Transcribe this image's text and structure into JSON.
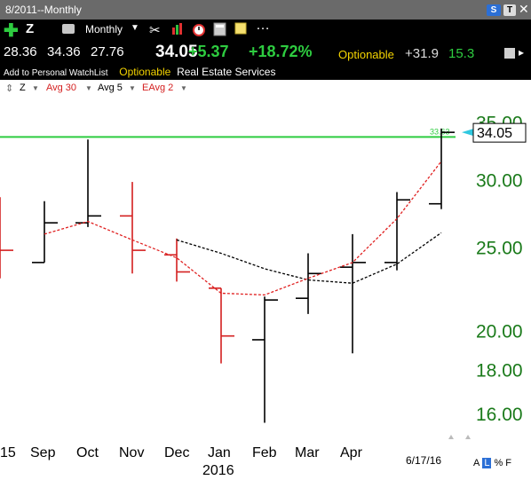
{
  "window": {
    "title": "8/2011--Monthly",
    "btn_s": "S",
    "btn_t": "T",
    "close": "✕"
  },
  "toolbar": {
    "symbol": "Z",
    "period": "Monthly",
    "add_label": "Add to Personal WatchList",
    "optionable": "Optionable",
    "industry": "Real Estate Services"
  },
  "quote": {
    "high": "28.36",
    "open": "34.36",
    "low": "27.76",
    "last": "34.05",
    "change": "+5.37",
    "change_pct": "+18.72%",
    "optionable": "Optionable",
    "value1": "+31.9",
    "value2": "15.3"
  },
  "studies": {
    "symbol": "Z",
    "avg30": "Avg 30",
    "avg5": "Avg 5",
    "eavg2": "EAvg 2"
  },
  "chart_data": {
    "type": "ohlc",
    "title": "",
    "x_labels": [
      "15",
      "Sep",
      "Oct",
      "Nov",
      "Dec",
      "Jan",
      "Feb",
      "Mar",
      "Apr"
    ],
    "year_label": "2016",
    "date_label": "6/17/16",
    "y_ticks": [
      "35.00",
      "30.00",
      "25.00",
      "20.00",
      "18.00",
      "16.00"
    ],
    "y_tick_values": [
      35,
      30,
      25,
      20,
      18,
      16
    ],
    "ylim": [
      15,
      36.5
    ],
    "log_scale": true,
    "price_tag": "34.05",
    "line_label": "33.63",
    "horizontal_line": 33.63,
    "bars": [
      {
        "open": 24.8,
        "high": 28.6,
        "low": 23.0,
        "close": 24.8,
        "color": "#d42020"
      },
      {
        "open": 24.0,
        "high": 28.3,
        "low": 24.0,
        "close": 26.7,
        "color": "#000000"
      },
      {
        "open": 26.7,
        "high": 33.4,
        "low": 26.4,
        "close": 27.2,
        "color": "#000000"
      },
      {
        "open": 27.2,
        "high": 29.8,
        "low": 23.3,
        "close": 24.8,
        "color": "#d42020"
      },
      {
        "open": 24.5,
        "high": 25.6,
        "low": 22.8,
        "close": 23.4,
        "color": "#d42020"
      },
      {
        "open": 22.4,
        "high": 22.4,
        "low": 18.3,
        "close": 19.7,
        "color": "#d42020"
      },
      {
        "open": 19.5,
        "high": 21.9,
        "low": 15.6,
        "close": 21.7,
        "color": "#000000"
      },
      {
        "open": 21.8,
        "high": 24.6,
        "low": 20.9,
        "close": 23.3,
        "color": "#000000"
      },
      {
        "open": 23.7,
        "high": 25.9,
        "low": 18.8,
        "close": 24.0,
        "color": "#000000"
      },
      {
        "open": 24.0,
        "high": 29.0,
        "low": 23.5,
        "close": 28.4,
        "color": "#000000"
      },
      {
        "open": 28.1,
        "high": 34.4,
        "low": 27.7,
        "close": 34.05,
        "color": "#000000"
      }
    ],
    "series": [
      {
        "name": "Avg 5",
        "color": "#000000",
        "values": [
          null,
          null,
          null,
          null,
          25.5,
          24.6,
          23.6,
          22.9,
          22.7,
          23.9,
          26.0
        ]
      },
      {
        "name": "EAvg 2",
        "color": "#e02020",
        "values": [
          null,
          25.9,
          26.8,
          25.5,
          24.3,
          22.1,
          22.0,
          23.0,
          24.0,
          27.0,
          31.5
        ]
      }
    ]
  }
}
